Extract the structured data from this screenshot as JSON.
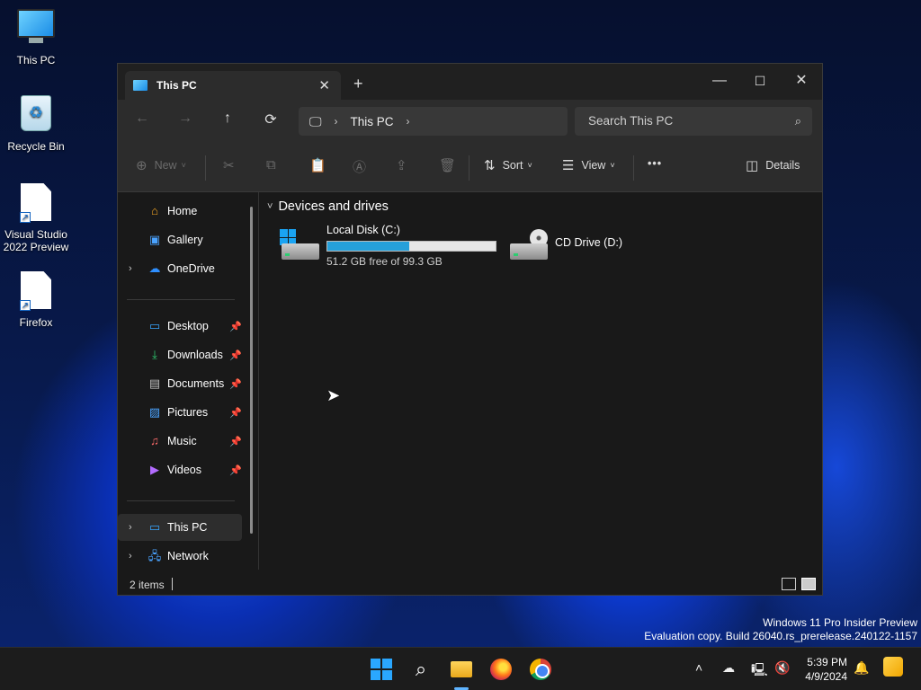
{
  "desktop": {
    "icons": [
      {
        "label": "This PC"
      },
      {
        "label": "Recycle Bin"
      },
      {
        "label": "Visual Studio 2022 Preview"
      },
      {
        "label": "Firefox"
      }
    ]
  },
  "window": {
    "tab_title": "This PC",
    "tab_close": "✕",
    "new_tab": "+",
    "controls": {
      "minimize": "—",
      "maximize": "☐",
      "close": "✕"
    }
  },
  "navbar": {
    "back": "←",
    "forward": "→",
    "up": "↑",
    "refresh": "⟳",
    "address_segment": "This PC",
    "search_placeholder": "Search This PC"
  },
  "toolbar": {
    "new_label": "New",
    "sort_label": "Sort",
    "view_label": "View",
    "more_label": "•••",
    "details_label": "Details"
  },
  "nav_pane": {
    "items": [
      {
        "label": "Home"
      },
      {
        "label": "Gallery"
      },
      {
        "label": "OneDrive"
      },
      {
        "label": "Desktop"
      },
      {
        "label": "Downloads"
      },
      {
        "label": "Documents"
      },
      {
        "label": "Pictures"
      },
      {
        "label": "Music"
      },
      {
        "label": "Videos"
      },
      {
        "label": "This PC"
      },
      {
        "label": "Network"
      }
    ]
  },
  "content": {
    "group_title": "Devices and drives",
    "drives": [
      {
        "name": "Local Disk (C:)",
        "free_text": "51.2 GB free of 99.3 GB",
        "used_fraction": 0.484
      },
      {
        "name": "CD Drive (D:)"
      }
    ]
  },
  "statusbar": {
    "item_count": "2 items"
  },
  "watermark": {
    "line1": "Windows 11 Pro Insider Preview",
    "line2": "Evaluation copy. Build 26040.rs_prerelease.240122-1157"
  },
  "taskbar": {
    "time": "5:39 PM",
    "date": "4/9/2024"
  },
  "colors": {
    "accent": "#26a0da",
    "window_bg": "#191919",
    "chrome_bg": "#2c2c2c"
  }
}
